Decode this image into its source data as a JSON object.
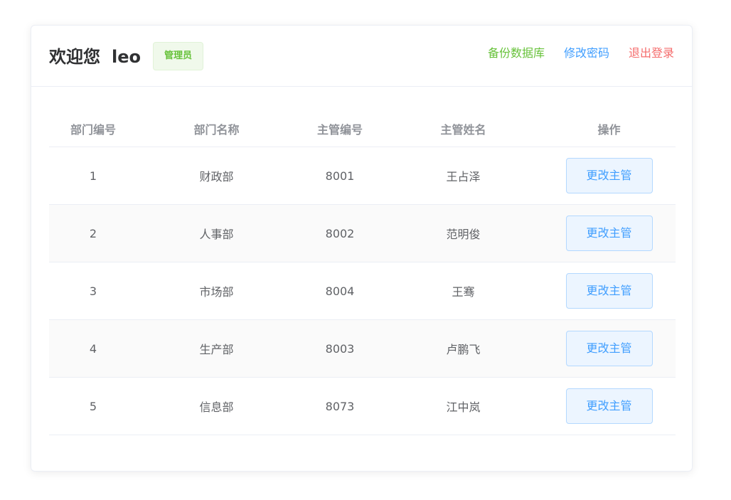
{
  "header": {
    "welcome_text": "欢迎您",
    "username": "leo",
    "role_badge": "管理员",
    "links": {
      "backup": "备份数据库",
      "change_password": "修改密码",
      "logout": "退出登录"
    }
  },
  "table": {
    "columns": [
      "部门编号",
      "部门名称",
      "主管编号",
      "主管姓名",
      "操作"
    ],
    "rows": [
      {
        "dept_id": "1",
        "dept_name": "财政部",
        "manager_id": "8001",
        "manager_name": "王占泽",
        "action": "更改主管"
      },
      {
        "dept_id": "2",
        "dept_name": "人事部",
        "manager_id": "8002",
        "manager_name": "范明俊",
        "action": "更改主管"
      },
      {
        "dept_id": "3",
        "dept_name": "市场部",
        "manager_id": "8004",
        "manager_name": "王骞",
        "action": "更改主管"
      },
      {
        "dept_id": "4",
        "dept_name": "生产部",
        "manager_id": "8003",
        "manager_name": "卢鹏飞",
        "action": "更改主管"
      },
      {
        "dept_id": "5",
        "dept_name": "信息部",
        "manager_id": "8073",
        "manager_name": "江中岚",
        "action": "更改主管"
      }
    ]
  },
  "colors": {
    "success": "#67c23a",
    "primary": "#409eff",
    "danger": "#f56c6c",
    "text_primary": "#303133",
    "text_regular": "#606266",
    "text_secondary": "#909399"
  }
}
